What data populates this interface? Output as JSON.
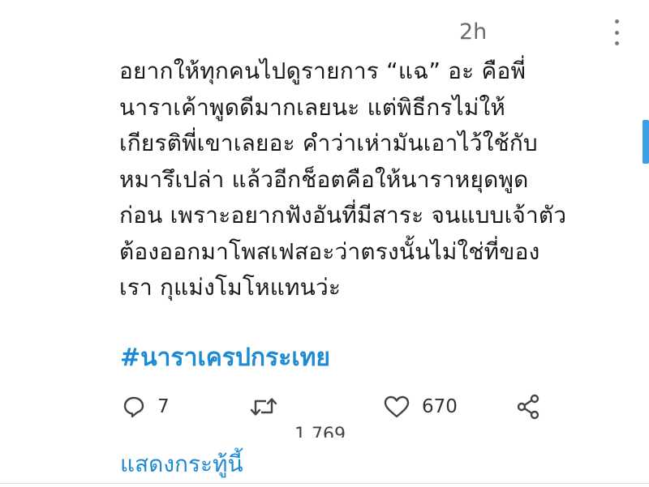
{
  "tweet": {
    "timestamp": "2h",
    "text": "อยากให้ทุกคนไปดูรายการ “แฉ” อะ คือพี่\nนาราเค้าพูดดีมากเลยนะ แต่พิธีกรไม่ให้\nเกียรติพี่เขาเลยอะ คำว่าเห่ามันเอาไว้ใช้กับ\nหมารึเปล่า แล้วอีกช็อตคือให้นาราหยุดพูด\nก่อน เพราะอยากฟังอันที่มีสาระ จนแบบเจ้าตัว\nต้องออกมาโพสเฟสอะว่าตรงนั้นไม่ใช่ที่ของ\nเรา กุแม่งโมโหแทนว่ะ",
    "hashtag": "#นาราเครปกระเทย",
    "actions": {
      "reply_count": "7",
      "like_count": "670",
      "retweet_count_partial": "1,769"
    },
    "show_thread": "แสดงกระทู้นี้"
  },
  "icons": {
    "reply": "reply-icon",
    "retweet": "retweet-icon",
    "like": "heart-icon",
    "share": "share-icon",
    "overflow": "more-vertical-icon"
  },
  "colors": {
    "accent": "#1d8ad4",
    "text": "#1a1a1a",
    "muted": "#6b6b6b",
    "scrollbar": "#3aa0e6"
  }
}
